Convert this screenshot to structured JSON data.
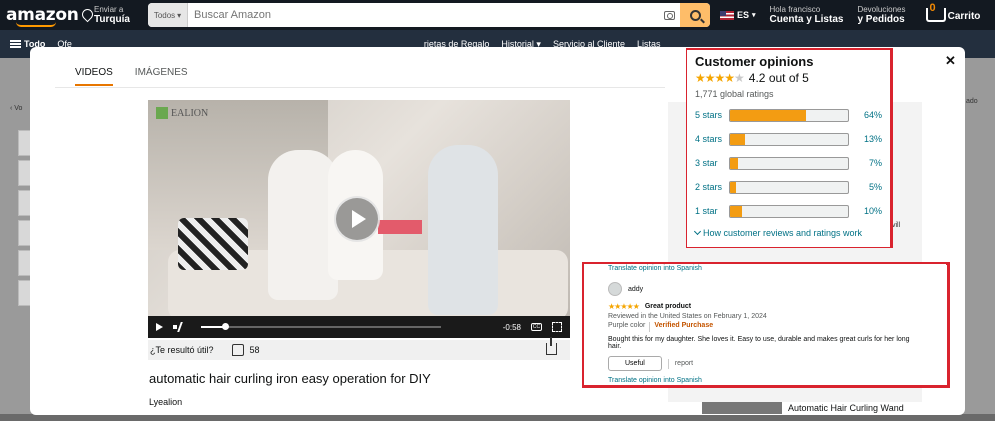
{
  "header": {
    "logo": "amazon",
    "deliver_top": "Enviar a",
    "deliver_bottom": "Turquía",
    "search_category": "Todos",
    "search_placeholder": "Buscar Amazon",
    "language": "ES",
    "account_top": "Hola francisco",
    "account_bottom": "Cuenta y Listas",
    "returns_top": "Devoluciones",
    "returns_bottom": "y Pedidos",
    "cart_count": "0",
    "cart_label": "Carrito"
  },
  "nav": {
    "all": "Todo",
    "items": [
      "Ofe",
      "rjetas de Regalo",
      "Historial",
      "Servicio al Cliente",
      "Listas"
    ]
  },
  "page": {
    "left_fragment": "‹ Vo",
    "right_fragment": "ado"
  },
  "modal": {
    "tabs": [
      "VIDEOS",
      "IMÁGENES"
    ],
    "close": "✕",
    "video": {
      "brand": "EALION",
      "time": "-0:58",
      "cc": "CC",
      "progress": 0.1
    },
    "helpful_question": "¿Te resultó útil?",
    "helpful_count": "58",
    "title": "automatic hair curling iron easy operation for DIY",
    "brand": "Lyealion",
    "related_title": "Automatic Hair Curling Wand",
    "related_fragment": "vill"
  },
  "opinions": {
    "title": "Customer opinions",
    "rating_text": "4.2 out of 5",
    "rating": 4.2,
    "global_ratings": "1,771 global ratings",
    "histogram": [
      {
        "label": "5 stars",
        "pct": "64%",
        "value": 64
      },
      {
        "label": "4 stars",
        "pct": "13%",
        "value": 13
      },
      {
        "label": "3 star",
        "pct": "7%",
        "value": 7
      },
      {
        "label": "2 stars",
        "pct": "5%",
        "value": 5
      },
      {
        "label": "1 star",
        "pct": "10%",
        "value": 10
      }
    ],
    "link": "How customer reviews and ratings work"
  },
  "review": {
    "translate_top": "Translate opinion into Spanish",
    "user": "addy",
    "stars": "★★★★★",
    "title": "Great product",
    "meta": "Reviewed in the United States on February 1, 2024",
    "variant": "Purple color",
    "verified": "Verified Purchase",
    "body": "Bought this for my daughter. She loves it. Easy to use, durable and makes great curls for her long hair.",
    "useful_label": "Useful",
    "report_label": "report",
    "translate_bottom": "Translate opinion into Spanish"
  },
  "colors": {
    "header_bg": "#131921",
    "nav_bg": "#232f3e",
    "accent_orange": "#ff9900",
    "search_button": "#febd69",
    "highlight_red": "#d9232e",
    "link": "#007185",
    "star": "#f5a500"
  }
}
